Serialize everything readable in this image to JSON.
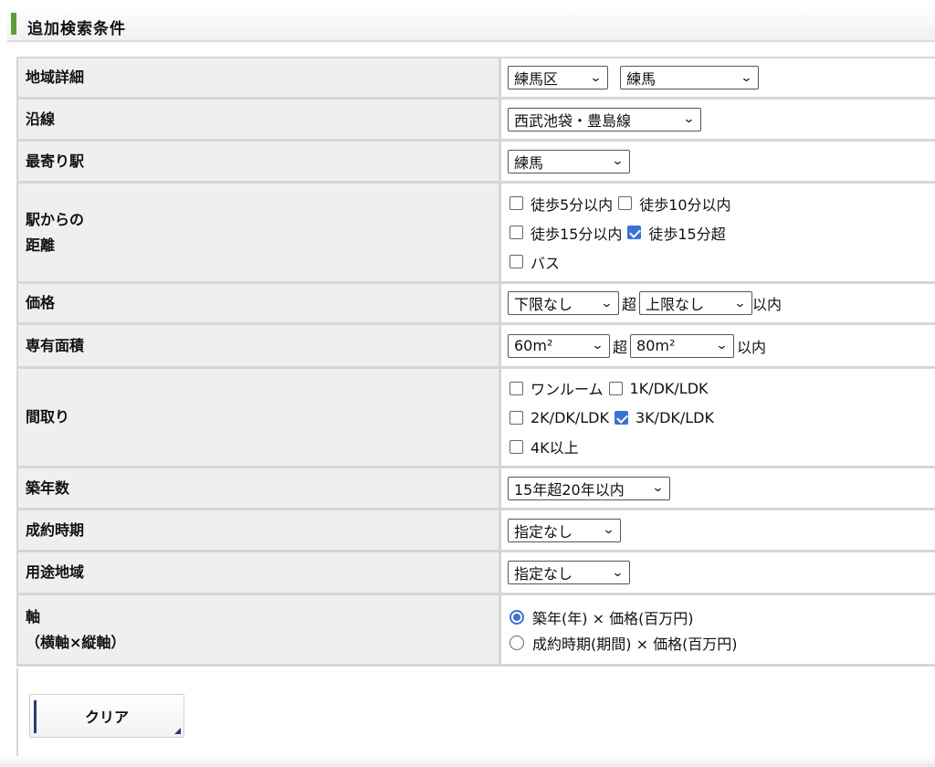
{
  "header": {
    "title": "追加検索条件"
  },
  "rows": {
    "area": {
      "label": "地域詳細",
      "select1": "練馬区",
      "select2": "練馬"
    },
    "line": {
      "label": "沿線",
      "select": "西武池袋・豊島線"
    },
    "station": {
      "label": "最寄り駅",
      "select": "練馬"
    },
    "distance": {
      "label1": "駅からの",
      "label2": "距離",
      "options": [
        {
          "label": "徒歩5分以内",
          "checked": false
        },
        {
          "label": "徒歩10分以内",
          "checked": false
        },
        {
          "label": "徒歩15分以内",
          "checked": false
        },
        {
          "label": "徒歩15分超",
          "checked": true
        },
        {
          "label": "バス",
          "checked": false
        }
      ]
    },
    "price": {
      "label": "価格",
      "min": "下限なし",
      "over": "超",
      "max": "上限なし",
      "within": "以内"
    },
    "area_size": {
      "label": "専有面積",
      "min": "60m²",
      "over": "超",
      "max": "80m²",
      "within": "以内"
    },
    "layout": {
      "label": "間取り",
      "options": [
        {
          "label": "ワンルーム",
          "checked": false
        },
        {
          "label": "1K/DK/LDK",
          "checked": false
        },
        {
          "label": "2K/DK/LDK",
          "checked": false
        },
        {
          "label": "3K/DK/LDK",
          "checked": true
        },
        {
          "label": "4K以上",
          "checked": false
        }
      ]
    },
    "age": {
      "label": "築年数",
      "select": "15年超20年以内"
    },
    "contract": {
      "label": "成約時期",
      "select": "指定なし"
    },
    "zoning": {
      "label": "用途地域",
      "select": "指定なし"
    },
    "axis": {
      "label1": "軸",
      "label2": "（横軸×縦軸）",
      "options": [
        {
          "label": "築年(年) × 価格(百万円)",
          "selected": true
        },
        {
          "label": "成約時期(期間) × 価格(百万円)",
          "selected": false
        }
      ]
    }
  },
  "buttons": {
    "clear": "クリア"
  },
  "colors": {
    "accent": "#5f9d3a",
    "check": "#3b72d9",
    "label_bg": "#efefef",
    "border": "#d6d6d6"
  },
  "icons": {
    "select_arrow": "chevron-down-icon",
    "clear_corner": "corner-triangle-icon"
  }
}
